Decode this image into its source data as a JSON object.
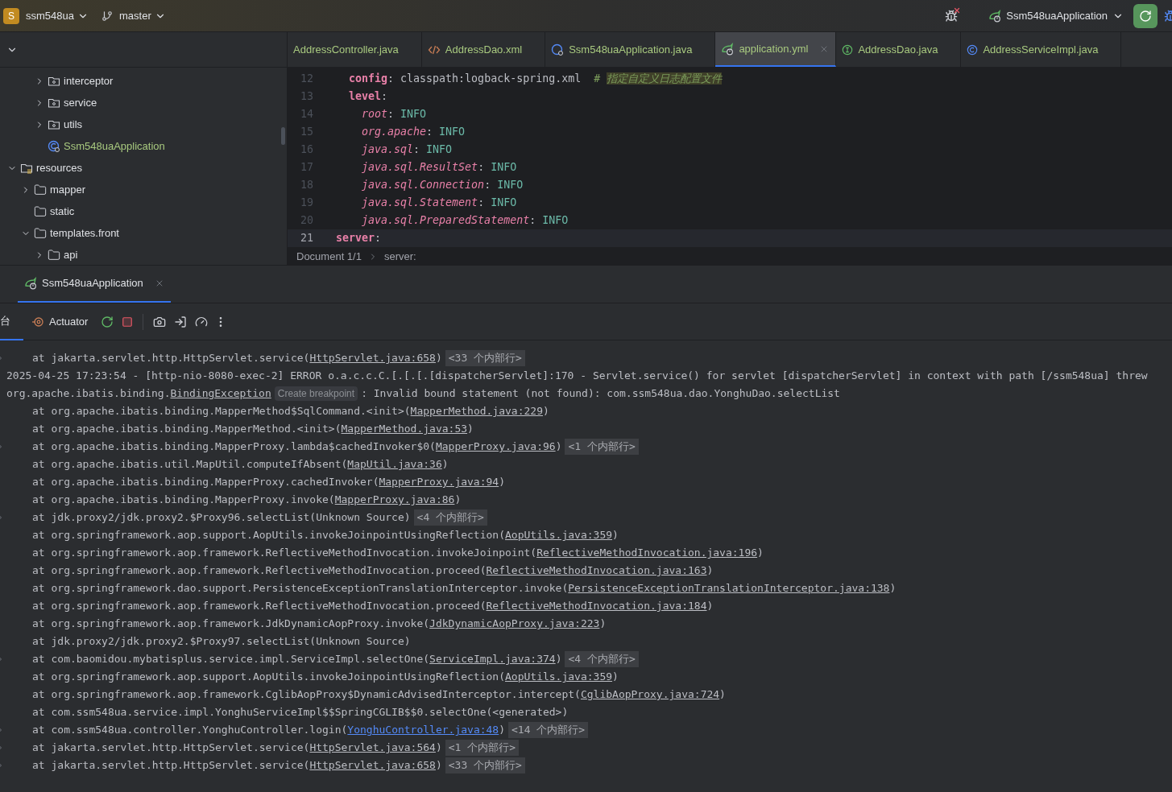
{
  "top_bar": {
    "project_badge": "S",
    "project": "ssm548ua",
    "branch": "master",
    "run_config": "Ssm548uaApplication"
  },
  "project_tree": {
    "items": [
      {
        "children": [
          {
            "children": [
              {
                "label": "interceptor",
                "kind": "package",
                "expanded": false
              },
              {
                "label": "service",
                "kind": "package",
                "expanded": false
              },
              {
                "label": "utils",
                "kind": "package",
                "expanded": false
              },
              {
                "label": "Ssm548uaApplication",
                "kind": "class"
              }
            ]
          }
        ]
      },
      {
        "label": "resources",
        "kind": "resources",
        "expanded": true,
        "children": [
          {
            "label": "mapper",
            "kind": "folder",
            "expanded": false
          },
          {
            "label": "static",
            "kind": "folder"
          },
          {
            "label": "templates.front",
            "kind": "folder",
            "expanded": true,
            "children": [
              {
                "label": "api",
                "kind": "folder",
                "expanded": false
              }
            ]
          }
        ]
      }
    ]
  },
  "editor_tabs": [
    {
      "label": "AddressController.java",
      "kind": "plain",
      "selected": false
    },
    {
      "label": "AddressDao.xml",
      "kind": "xml",
      "selected": false
    },
    {
      "label": "Ssm548uaApplication.java",
      "kind": "app",
      "selected": false
    },
    {
      "label": "application.yml",
      "kind": "yml",
      "selected": true
    },
    {
      "label": "AddressDao.java",
      "kind": "interface",
      "selected": false
    },
    {
      "label": "AddressServiceImpl.java",
      "kind": "class",
      "selected": false
    }
  ],
  "code_lines": [
    {
      "number": "12",
      "current": false,
      "segments": [
        {
          "kind": "key",
          "text": "  config"
        },
        {
          "kind": "plain",
          "text": ": classpath:logback-spring.xml  "
        },
        {
          "kind": "comment",
          "text": "# "
        },
        {
          "kind": "comment_highlight",
          "text": "指定自定义日志配置文件"
        }
      ]
    },
    {
      "number": "13",
      "current": false,
      "segments": [
        {
          "kind": "key",
          "text": "  level"
        },
        {
          "kind": "plain",
          "text": ":"
        }
      ]
    },
    {
      "number": "14",
      "current": false,
      "segments": [
        {
          "kind": "ikey",
          "text": "    root"
        },
        {
          "kind": "plain",
          "text": ": "
        },
        {
          "kind": "value",
          "text": "INFO"
        }
      ]
    },
    {
      "number": "15",
      "current": false,
      "segments": [
        {
          "kind": "ikey",
          "text": "    org.apache"
        },
        {
          "kind": "plain",
          "text": ": "
        },
        {
          "kind": "value",
          "text": "INFO"
        }
      ]
    },
    {
      "number": "16",
      "current": false,
      "segments": [
        {
          "kind": "ikey",
          "text": "    java.sql"
        },
        {
          "kind": "plain",
          "text": ": "
        },
        {
          "kind": "value",
          "text": "INFO"
        }
      ]
    },
    {
      "number": "17",
      "current": false,
      "segments": [
        {
          "kind": "ikey",
          "text": "    java.sql.ResultSet"
        },
        {
          "kind": "plain",
          "text": ": "
        },
        {
          "kind": "value",
          "text": "INFO"
        }
      ]
    },
    {
      "number": "18",
      "current": false,
      "segments": [
        {
          "kind": "ikey",
          "text": "    java.sql.Connection"
        },
        {
          "kind": "plain",
          "text": ": "
        },
        {
          "kind": "value",
          "text": "INFO"
        }
      ]
    },
    {
      "number": "19",
      "current": false,
      "segments": [
        {
          "kind": "ikey",
          "text": "    java.sql.Statement"
        },
        {
          "kind": "plain",
          "text": ": "
        },
        {
          "kind": "value",
          "text": "INFO"
        }
      ]
    },
    {
      "number": "20",
      "current": false,
      "segments": [
        {
          "kind": "ikey",
          "text": "    java.sql.PreparedStatement"
        },
        {
          "kind": "plain",
          "text": ": "
        },
        {
          "kind": "value",
          "text": "INFO"
        }
      ]
    },
    {
      "number": "21",
      "current": true,
      "segments": [
        {
          "kind": "key",
          "text": "server"
        },
        {
          "kind": "plain",
          "text": ":"
        }
      ]
    }
  ],
  "breadcrumb": [
    "Document 1/1",
    "server:"
  ],
  "run_panel": {
    "tab": {
      "label": "Ssm548uaApplication",
      "selected": true
    },
    "console_tab": "台",
    "actuator": "Actuator"
  },
  "console_lines": [
    {
      "kind": "frame",
      "pre": "at jakarta.servlet.http.HttpServlet.service(",
      "link": "HttpServlet.java:658",
      "post": ")",
      "folded": "<33 个内部行>",
      "expandable": true
    },
    {
      "kind": "message",
      "pre": "2025-04-25 17:23:54 - [http-nio-8080-exec-2] ERROR o.a.c.c.C.[.[.[.[dispatcherServlet]:170 - Servlet.service() for servlet [dispatcherServlet] in context with path [/ssm548ua] threw"
    },
    {
      "kind": "message",
      "pre": "org.apache.ibatis.binding.",
      "link": "BindingException",
      "hint": "Create breakpoint",
      "post": ": Invalid bound statement (not found): com.ssm548ua.dao.YonghuDao.selectList"
    },
    {
      "kind": "frame",
      "pre": "at org.apache.ibatis.binding.MapperMethod$SqlCommand.<init>(",
      "link": "MapperMethod.java:229",
      "post": ")",
      "expandable": false
    },
    {
      "kind": "frame",
      "pre": "at org.apache.ibatis.binding.MapperMethod.<init>(",
      "link": "MapperMethod.java:53",
      "post": ")",
      "expandable": false
    },
    {
      "kind": "frame",
      "pre": "at org.apache.ibatis.binding.MapperProxy.lambda$cachedInvoker$0(",
      "link": "MapperProxy.java:96",
      "post": ")",
      "folded": "<1 个内部行>",
      "expandable": true
    },
    {
      "kind": "frame",
      "pre": "at org.apache.ibatis.util.MapUtil.computeIfAbsent(",
      "link": "MapUtil.java:36",
      "post": ")",
      "expandable": false
    },
    {
      "kind": "frame",
      "pre": "at org.apache.ibatis.binding.MapperProxy.cachedInvoker(",
      "link": "MapperProxy.java:94",
      "post": ")",
      "expandable": false
    },
    {
      "kind": "frame",
      "pre": "at org.apache.ibatis.binding.MapperProxy.invoke(",
      "link": "MapperProxy.java:86",
      "post": ")",
      "expandable": false
    },
    {
      "kind": "frame",
      "pre": "at jdk.proxy2/jdk.proxy2.$Proxy96.selectList(Unknown Source)",
      "folded": "<4 个内部行>",
      "expandable": true
    },
    {
      "kind": "frame",
      "pre": "at org.springframework.aop.support.AopUtils.invokeJoinpointUsingReflection(",
      "link": "AopUtils.java:359",
      "post": ")",
      "expandable": false
    },
    {
      "kind": "frame",
      "pre": "at org.springframework.aop.framework.ReflectiveMethodInvocation.invokeJoinpoint(",
      "link": "ReflectiveMethodInvocation.java:196",
      "post": ")",
      "expandable": false
    },
    {
      "kind": "frame",
      "pre": "at org.springframework.aop.framework.ReflectiveMethodInvocation.proceed(",
      "link": "ReflectiveMethodInvocation.java:163",
      "post": ")",
      "expandable": false
    },
    {
      "kind": "frame",
      "pre": "at org.springframework.dao.support.PersistenceExceptionTranslationInterceptor.invoke(",
      "link": "PersistenceExceptionTranslationInterceptor.java:138",
      "post": ")",
      "expandable": false
    },
    {
      "kind": "frame",
      "pre": "at org.springframework.aop.framework.ReflectiveMethodInvocation.proceed(",
      "link": "ReflectiveMethodInvocation.java:184",
      "post": ")",
      "expandable": false
    },
    {
      "kind": "frame",
      "pre": "at org.springframework.aop.framework.JdkDynamicAopProxy.invoke(",
      "link": "JdkDynamicAopProxy.java:223",
      "post": ")",
      "expandable": false
    },
    {
      "kind": "frame",
      "pre": "at jdk.proxy2/jdk.proxy2.$Proxy97.selectList(Unknown Source)",
      "expandable": false
    },
    {
      "kind": "frame",
      "pre": "at com.baomidou.mybatisplus.service.impl.ServiceImpl.selectOne(",
      "link": "ServiceImpl.java:374",
      "post": ")",
      "folded": "<4 个内部行>",
      "expandable": true
    },
    {
      "kind": "frame",
      "pre": "at org.springframework.aop.support.AopUtils.invokeJoinpointUsingReflection(",
      "link": "AopUtils.java:359",
      "post": ")",
      "expandable": false
    },
    {
      "kind": "frame",
      "pre": "at org.springframework.aop.framework.CglibAopProxy$DynamicAdvisedInterceptor.intercept(",
      "link": "CglibAopProxy.java:724",
      "post": ")",
      "expandable": false
    },
    {
      "kind": "frame",
      "pre": "at com.ssm548ua.service.impl.YonghuServiceImpl$$SpringCGLIB$$0.selectOne(<generated>)",
      "expandable": false
    },
    {
      "kind": "frame",
      "pre": "at com.ssm548ua.controller.YonghuController.login(",
      "link": "YonghuController.java:48",
      "link_own": true,
      "post": ")",
      "folded": "<14 个内部行>",
      "expandable": true
    },
    {
      "kind": "frame",
      "pre": "at jakarta.servlet.http.HttpServlet.service(",
      "link": "HttpServlet.java:564",
      "post": ")",
      "folded": "<1 个内部行>",
      "expandable": true
    },
    {
      "kind": "frame",
      "pre": "at jakarta.servlet.http.HttpServlet.service(",
      "link": "HttpServlet.java:658",
      "post": ")",
      "folded": "<33 个内部行>",
      "expandable": true
    }
  ]
}
